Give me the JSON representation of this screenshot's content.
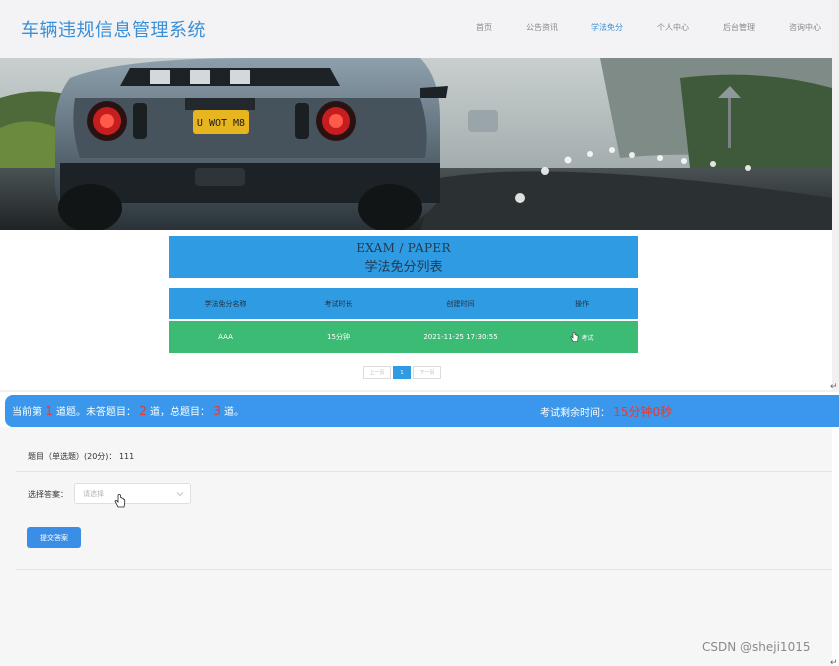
{
  "header": {
    "site_title": "车辆违规信息管理系统",
    "nav": [
      "首页",
      "公告资讯",
      "学法免分",
      "个人中心",
      "后台管理",
      "咨询中心"
    ],
    "active_nav": "学法免分"
  },
  "exam_list": {
    "title_en": "EXAM / PAPER",
    "title_cn": "学法免分列表",
    "columns": [
      "学法免分名称",
      "考试时长",
      "创建时间",
      "操作"
    ],
    "rows": [
      {
        "name": "AAA",
        "duration": "15分钟",
        "created": "2021-11-25 17:30:55",
        "action": "考试"
      }
    ]
  },
  "pager": {
    "prev": "上一页",
    "current": "1",
    "next": "下一页"
  },
  "status": {
    "prefix": "当前第",
    "current": "1",
    "mid1": "道题。未答题目：",
    "unanswered": "2",
    "mid2": "道，总题目：",
    "total": "3",
    "suffix": "道。",
    "timer_label": "考试剩余时间：",
    "timer_value": "15分钟0秒"
  },
  "question": {
    "text": "题目（单选题）(20分)： 111",
    "answer_label": "选择答案：",
    "select_placeholder": "请选择",
    "submit_label": "提交答案"
  },
  "watermark": "CSDN @sheji1015",
  "colors": {
    "primary": "#2f9be2",
    "row_green": "#3cbb75",
    "status_red": "#e63a32"
  }
}
